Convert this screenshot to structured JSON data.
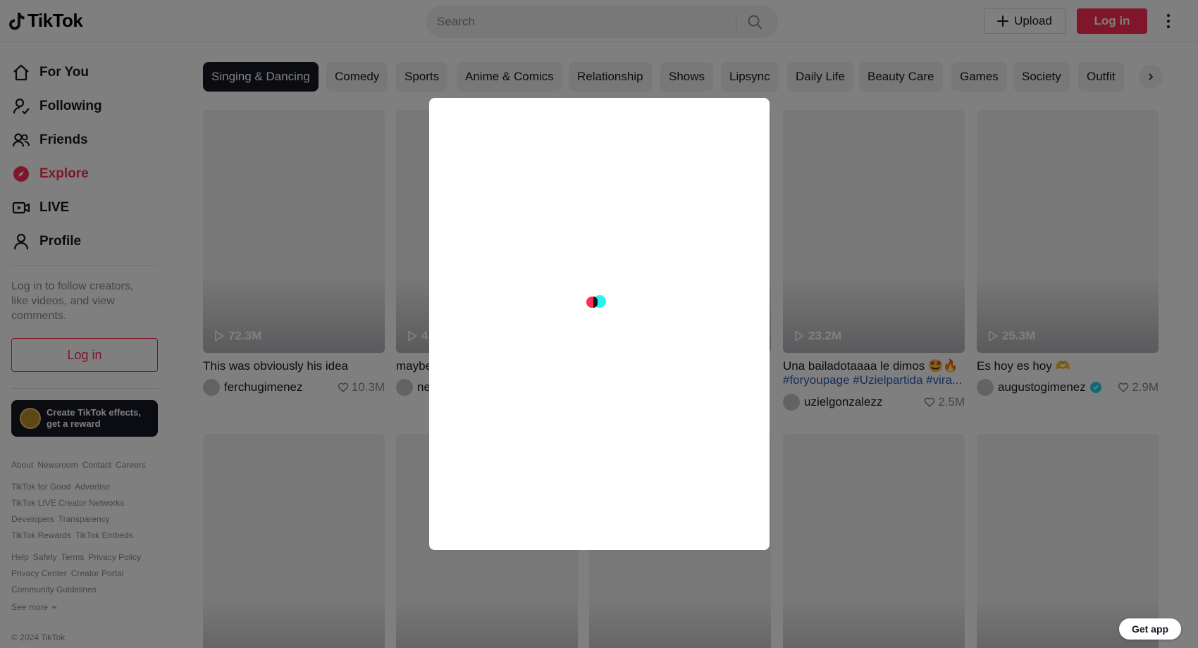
{
  "header": {
    "logo_text": "TikTok",
    "search_placeholder": "Search",
    "upload_label": "Upload",
    "login_label": "Log in"
  },
  "sidebar": {
    "nav": [
      {
        "label": "For You",
        "icon": "home-icon",
        "active": false
      },
      {
        "label": "Following",
        "icon": "following-icon",
        "active": false
      },
      {
        "label": "Friends",
        "icon": "friends-icon",
        "active": false
      },
      {
        "label": "Explore",
        "icon": "compass-icon",
        "active": true
      },
      {
        "label": "LIVE",
        "icon": "live-icon",
        "active": false
      },
      {
        "label": "Profile",
        "icon": "profile-icon",
        "active": false
      }
    ],
    "login_message": "Log in to follow creators, like videos, and view comments.",
    "login_button": "Log in",
    "effects_banner": "Create TikTok effects, get a reward",
    "footer": {
      "row1": [
        "About",
        "Newsroom",
        "Contact",
        "Careers"
      ],
      "row2": [
        "TikTok for Good",
        "Advertise"
      ],
      "row3": [
        "TikTok LIVE Creator Networks"
      ],
      "row4": [
        "Developers",
        "Transparency"
      ],
      "row5": [
        "TikTok Rewards",
        "TikTok Embeds"
      ],
      "row6": [
        "Help",
        "Safety",
        "Terms",
        "Privacy Policy"
      ],
      "row7": [
        "Privacy Center",
        "Creator Portal"
      ],
      "row8": [
        "Community Guidelines"
      ],
      "see_more": "See more",
      "copyright": "© 2024 TikTok"
    }
  },
  "categories": [
    "Singing & Dancing",
    "Comedy",
    "Sports",
    "Anime & Comics",
    "Relationship",
    "Shows",
    "Lipsync",
    "Daily Life",
    "Beauty Care",
    "Games",
    "Society",
    "Outfit"
  ],
  "videos": [
    {
      "views": "72.3M",
      "title": "This was obviously his idea",
      "tags": "",
      "author": "ferchugimenez",
      "verified": false,
      "likes": "10.3M"
    },
    {
      "views": "4",
      "title": "maybe",
      "tags": "",
      "author": "ne",
      "verified": false,
      "likes": ""
    },
    {
      "views": "",
      "title": "",
      "tags": "",
      "author": "",
      "verified": false,
      "likes": ""
    },
    {
      "views": "23.2M",
      "title": "Una bailadotaaaa le dimos 🤩🔥",
      "tags": "#foryoupage #Uzielpartida #vira...",
      "author": "uzielgonzalezz",
      "verified": false,
      "likes": "2.5M"
    },
    {
      "views": "25.3M",
      "title": "Es hoy es hoy 🫶",
      "tags": "",
      "author": "augustogimenez",
      "verified": true,
      "likes": "2.9M"
    }
  ],
  "get_app": "Get app",
  "colors": {
    "brand": "#fe2c55",
    "accent_cyan": "#25f4ee",
    "text": "#161823",
    "muted": "#8a8b91",
    "hashtag": "#2b5db9"
  }
}
